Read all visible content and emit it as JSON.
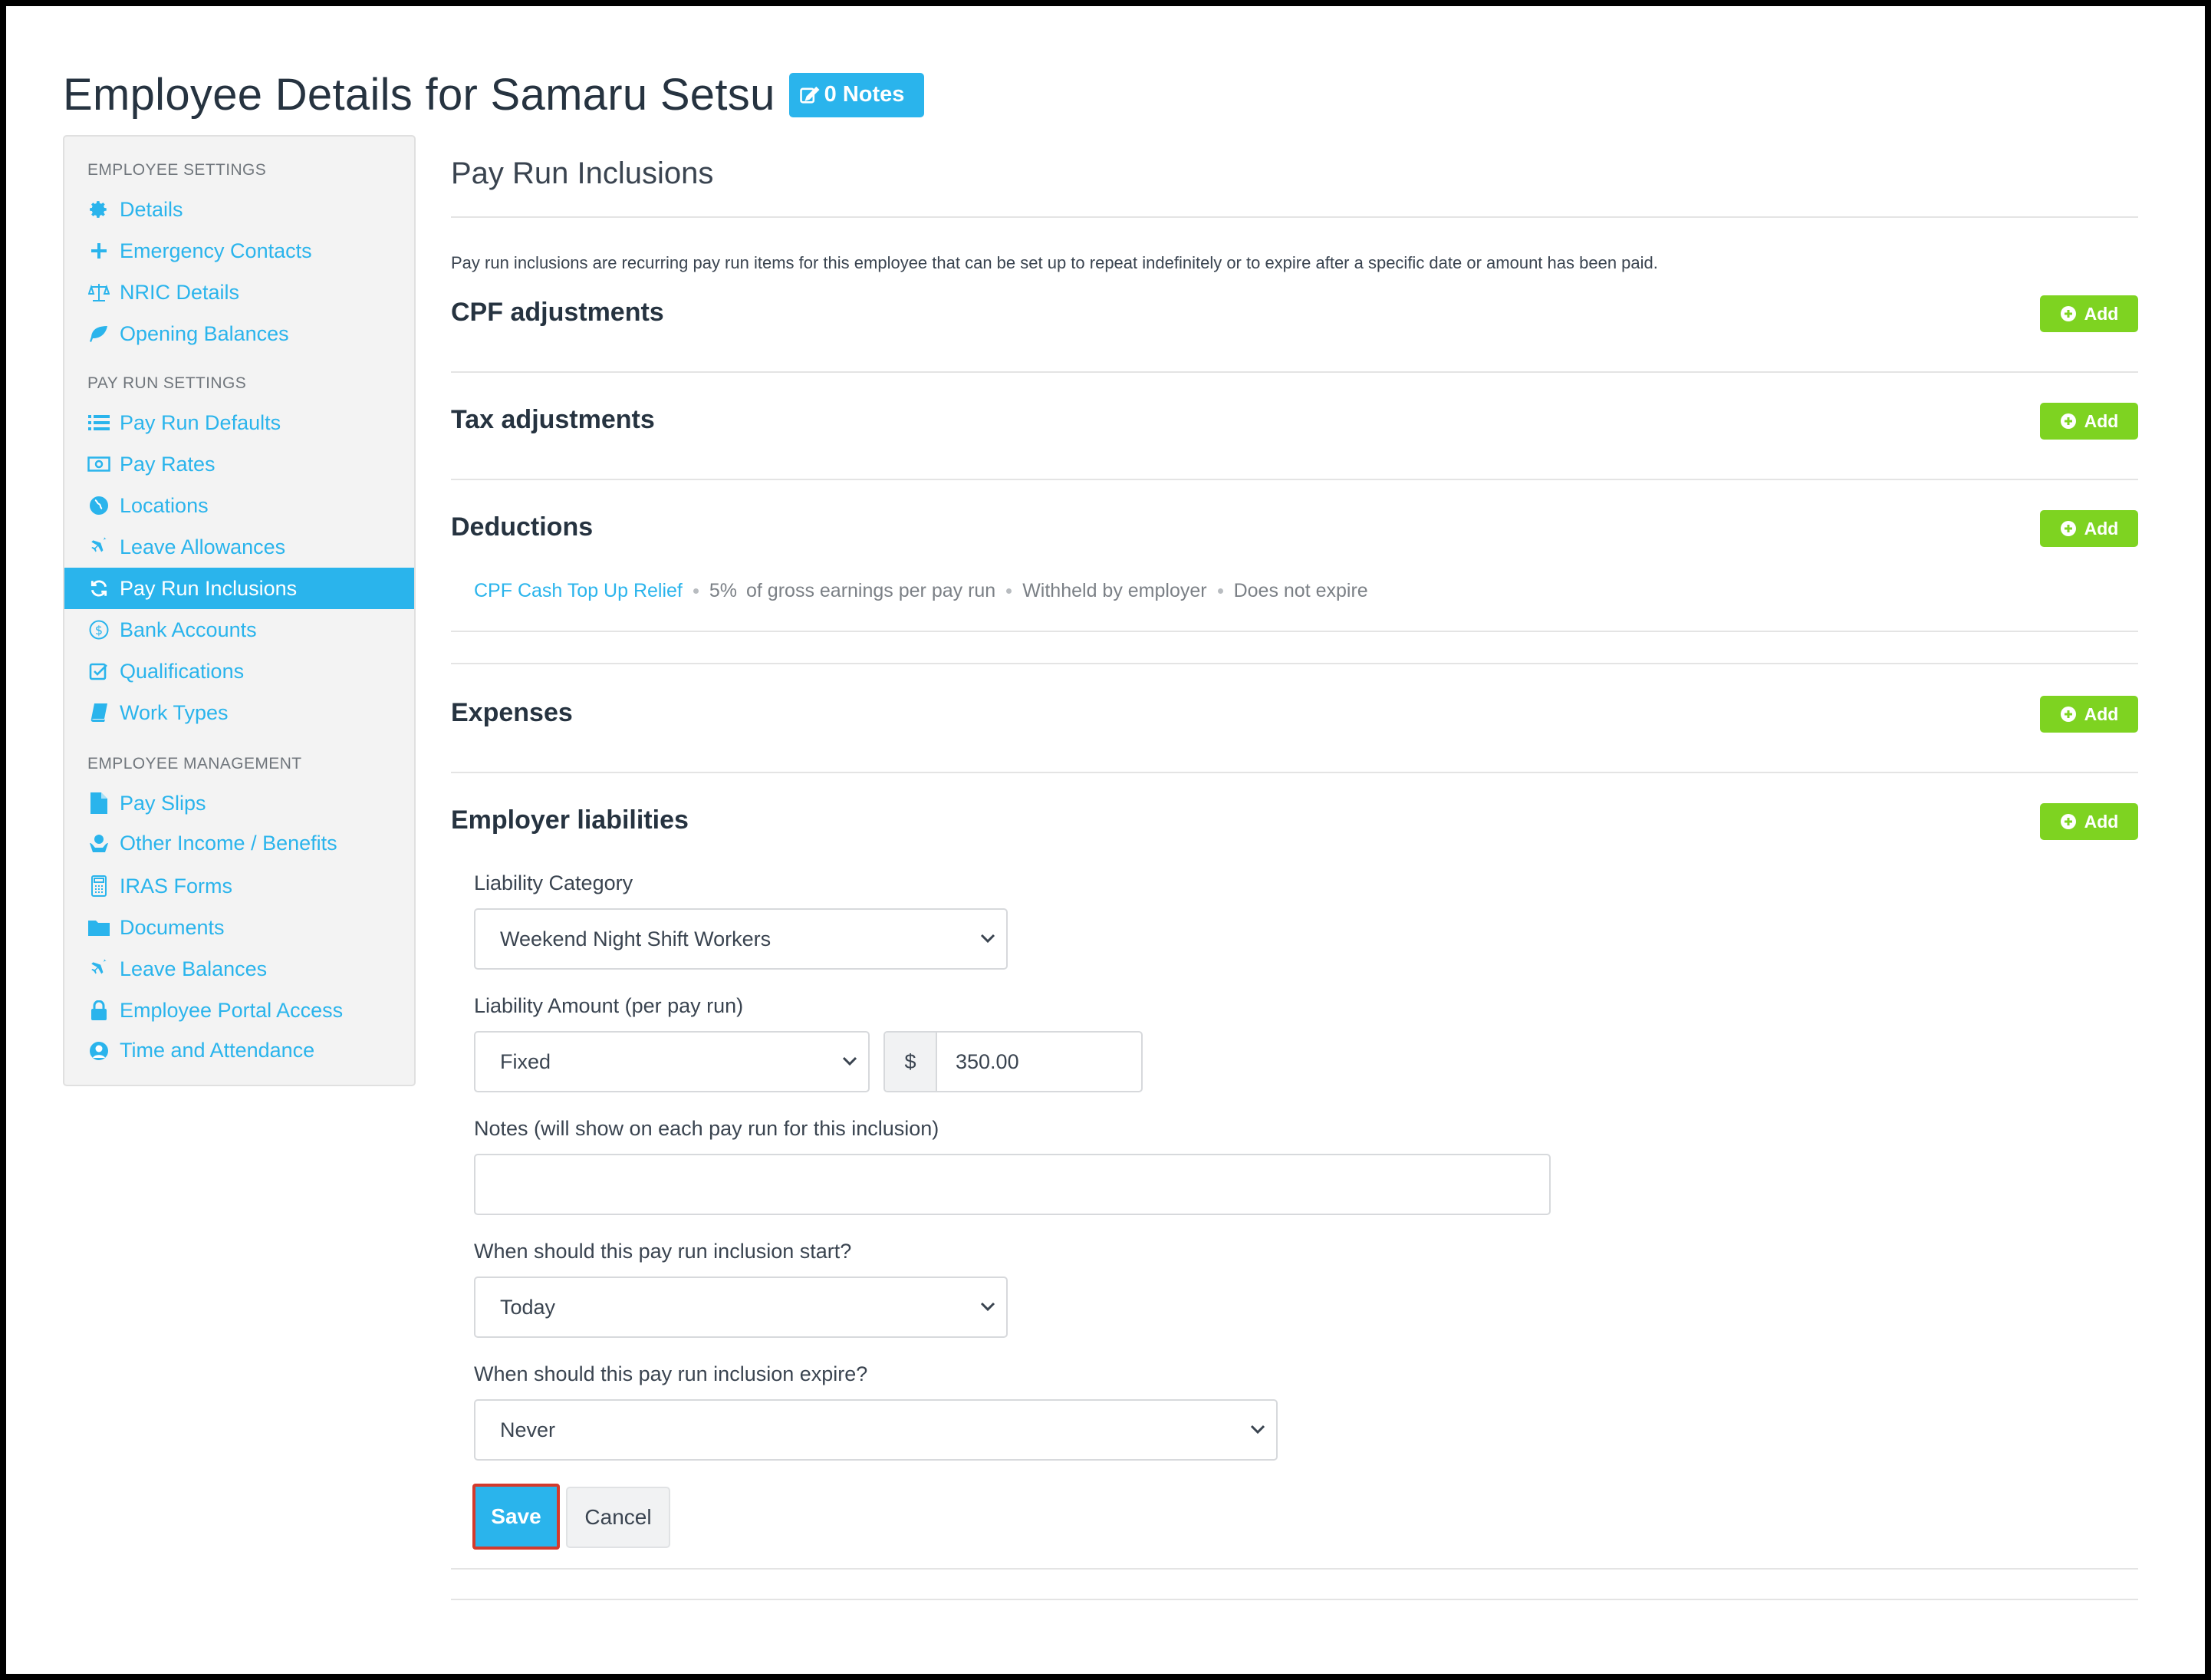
{
  "header": {
    "title": "Employee Details for Samaru Setsu",
    "notes_badge": "0 Notes"
  },
  "sidebar": {
    "sections": [
      {
        "heading": "EMPLOYEE SETTINGS",
        "items": [
          {
            "label": "Details",
            "icon": "gear-icon"
          },
          {
            "label": "Emergency Contacts",
            "icon": "plus-icon"
          },
          {
            "label": "NRIC Details",
            "icon": "scale-icon"
          },
          {
            "label": "Opening Balances",
            "icon": "leaf-icon"
          }
        ]
      },
      {
        "heading": "PAY RUN SETTINGS",
        "items": [
          {
            "label": "Pay Run Defaults",
            "icon": "list-icon"
          },
          {
            "label": "Pay Rates",
            "icon": "money-icon"
          },
          {
            "label": "Locations",
            "icon": "globe-icon"
          },
          {
            "label": "Leave Allowances",
            "icon": "plane-icon"
          },
          {
            "label": "Pay Run Inclusions",
            "icon": "refresh-icon",
            "active": true
          },
          {
            "label": "Bank Accounts",
            "icon": "dollar-circle-icon"
          },
          {
            "label": "Qualifications",
            "icon": "checkbox-icon"
          },
          {
            "label": "Work Types",
            "icon": "book-icon"
          }
        ]
      },
      {
        "heading": "EMPLOYEE MANAGEMENT",
        "items": [
          {
            "label": "Pay Slips",
            "icon": "file-icon"
          },
          {
            "label": "Other Income / Benefits",
            "icon": "hand-icon"
          },
          {
            "label": "IRAS Forms",
            "icon": "calculator-icon"
          },
          {
            "label": "Documents",
            "icon": "folder-icon"
          },
          {
            "label": "Leave Balances",
            "icon": "plane-icon"
          },
          {
            "label": "Employee Portal Access",
            "icon": "lock-icon"
          },
          {
            "label": "Time and Attendance",
            "icon": "user-clock-icon"
          }
        ]
      }
    ]
  },
  "main": {
    "section_title": "Pay Run Inclusions",
    "intro": "Pay run inclusions are recurring pay run items for this employee that can be set up to repeat indefinitely or to expire after a specific date or amount has been paid.",
    "add_label": "Add",
    "groups": [
      {
        "title": "CPF adjustments"
      },
      {
        "title": "Tax adjustments"
      },
      {
        "title": "Deductions"
      },
      {
        "title": "Expenses"
      },
      {
        "title": "Employer liabilities"
      }
    ],
    "deduction_item": {
      "name": "CPF Cash Top Up Relief",
      "amount": "5%",
      "basis": "of gross earnings per pay run",
      "withheld": "Withheld by employer",
      "expiry": "Does not expire"
    },
    "form": {
      "liability_category_label": "Liability Category",
      "liability_category_value": "Weekend Night Shift Workers",
      "liability_amount_label": "Liability Amount (per pay run)",
      "amount_type_value": "Fixed",
      "currency_symbol": "$",
      "amount_value": "350.00",
      "notes_label": "Notes (will show on each pay run for this inclusion)",
      "notes_value": "",
      "start_label": "When should this pay run inclusion start?",
      "start_value": "Today",
      "expire_label": "When should this pay run inclusion expire?",
      "expire_value": "Never",
      "save_label": "Save",
      "cancel_label": "Cancel"
    }
  },
  "colors": {
    "accent": "#2ab4ec",
    "add_button": "#7ed321",
    "save_highlight_border": "#d33a2c"
  }
}
